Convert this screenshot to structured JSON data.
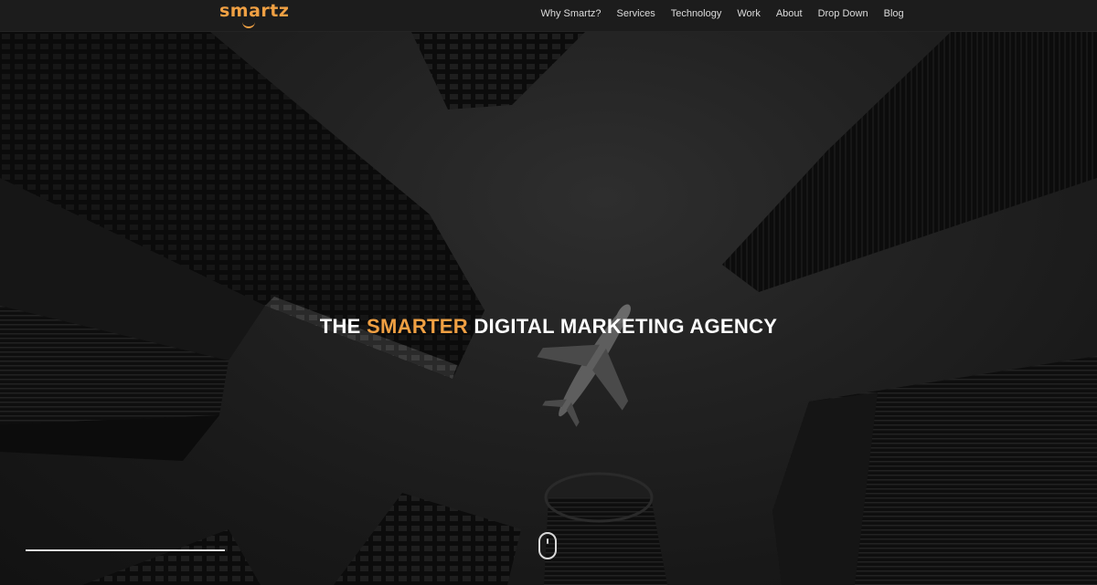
{
  "header": {
    "logo_text": "smartz",
    "nav": [
      {
        "label": "Why Smartz?"
      },
      {
        "label": "Services"
      },
      {
        "label": "Technology"
      },
      {
        "label": "Work"
      },
      {
        "label": "About"
      },
      {
        "label": "Drop Down"
      },
      {
        "label": "Blog"
      }
    ]
  },
  "hero": {
    "headline_pre": "THE ",
    "headline_accent": "SMARTER",
    "headline_post": " DIGITAL MARKETING AGENCY"
  },
  "colors": {
    "accent": "#f0a043",
    "header_bg": "#1c1c1c",
    "hero_bg": "#1a1a1a",
    "text": "#ffffff"
  }
}
